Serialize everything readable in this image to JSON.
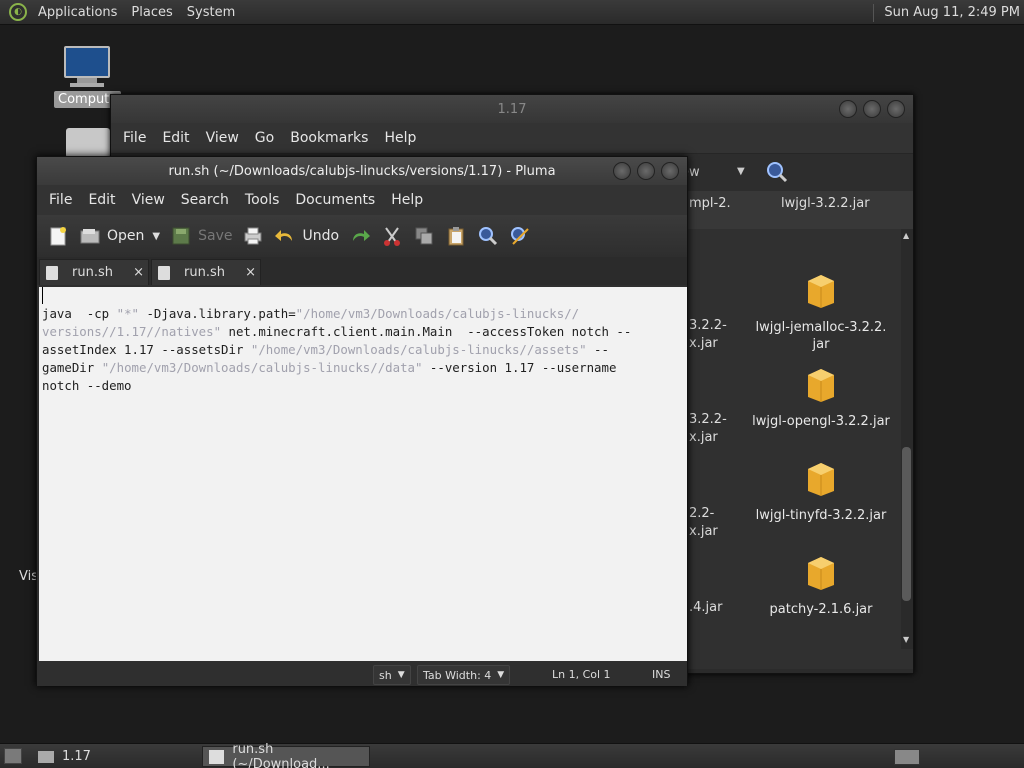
{
  "top_panel": {
    "menus": [
      "Applications",
      "Places",
      "System"
    ],
    "clock": "Sun Aug 11, 2:49 PM"
  },
  "desktop": {
    "computer_label": "Compute",
    "vis_label": "Vis"
  },
  "caja": {
    "title": "1.17",
    "menus": [
      "File",
      "Edit",
      "View",
      "Go",
      "Bookmarks",
      "Help"
    ],
    "view_label": "ew",
    "top_labels": [
      {
        "text": "mpl-2.",
        "col": "left"
      },
      {
        "text": "lwjgl-3.2.2.jar",
        "col": "right"
      }
    ],
    "left_partial_labels": [
      "3.2.2-",
      "x.jar",
      "3.2.2-",
      "x.jar",
      "2.2-",
      "x.jar",
      ".4.jar"
    ],
    "files": [
      {
        "name_line1": "lwjgl-jemalloc-3.2.2.",
        "name_line2": "jar"
      },
      {
        "name_line1": "lwjgl-opengl-3.2.2.jar",
        "name_line2": ""
      },
      {
        "name_line1": "lwjgl-tinyfd-3.2.2.jar",
        "name_line2": ""
      },
      {
        "name_line1": "patchy-2.1.6.jar",
        "name_line2": ""
      }
    ]
  },
  "pluma": {
    "title": "run.sh (~/Downloads/calubjs-linucks/versions/1.17) - Pluma",
    "menus": [
      "File",
      "Edit",
      "View",
      "Search",
      "Tools",
      "Documents",
      "Help"
    ],
    "toolbar": {
      "open_label": "Open",
      "save_label": "Save",
      "undo_label": "Undo"
    },
    "tabs": [
      {
        "label": "run.sh",
        "close": "×"
      },
      {
        "label": "run.sh",
        "close": "×"
      }
    ],
    "code": {
      "l1_a": "java  -cp ",
      "l1_b": "\"*\"",
      "l1_c": " -Djava.library.path=",
      "l1_d": "\"/home/vm3/Downloads/calubjs-linucks//",
      "l2_a": "versions//1.17//natives\"",
      "l2_b": " net.minecraft.client.main.Main  --accessToken notch --",
      "l3_a": "assetIndex 1.17 --assetsDir ",
      "l3_b": "\"/home/vm3/Downloads/calubjs-linucks//assets\"",
      "l3_c": " --",
      "l4_a": "gameDir ",
      "l4_b": "\"/home/vm3/Downloads/calubjs-linucks//data\"",
      "l4_c": " --version 1.17 --username",
      "l5_a": "notch --demo"
    },
    "status": {
      "language": "sh",
      "tab_width": "Tab Width:  4",
      "position": "Ln 1, Col 1",
      "mode": "INS"
    }
  },
  "bottom_panel": {
    "task1": "1.17",
    "task2": "run.sh (~/Download..."
  }
}
